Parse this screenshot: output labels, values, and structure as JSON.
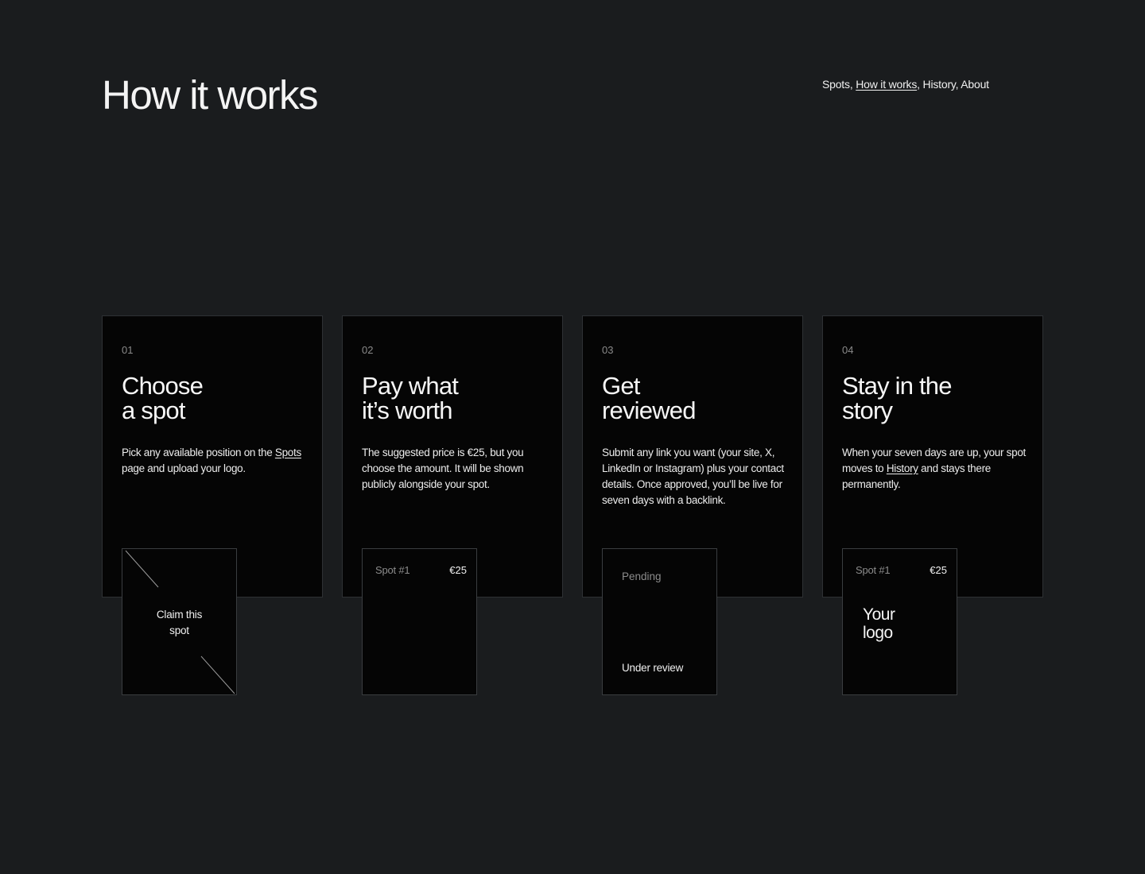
{
  "header": {
    "title": "How it works"
  },
  "nav": {
    "items": [
      {
        "label": "Spots",
        "sep": ", "
      },
      {
        "label": "How it works",
        "sep": ", "
      },
      {
        "label": "History",
        "sep": ", "
      },
      {
        "label": "About",
        "sep": ""
      }
    ]
  },
  "steps": [
    {
      "num": "01",
      "title_line1": "Choose",
      "title_line2": "a spot",
      "desc_before": "Pick any available position on the ",
      "desc_link": "Spots",
      "desc_after": " page and upload your logo."
    },
    {
      "num": "02",
      "title_line1": "Pay what",
      "title_line2": "it’s worth",
      "desc": "The suggested price is €25, but you choose the amount. It will be shown publicly alongside your spot."
    },
    {
      "num": "03",
      "title_line1": "Get",
      "title_line2": "reviewed",
      "desc": "Submit any link you want (your site, X, LinkedIn or Instagram) plus your contact details. Once approved, you’ll be live for seven days with a backlink."
    },
    {
      "num": "04",
      "title_line1": "Stay in the",
      "title_line2": "story",
      "desc_before": "When your seven days are up, your spot moves to ",
      "desc_link": "History",
      "desc_after": " and stays there permanently."
    }
  ],
  "previews": {
    "claim": {
      "line1": "Claim this",
      "line2": "spot"
    },
    "pay": {
      "spot": "Spot #1",
      "price": "€25"
    },
    "review": {
      "status": "Pending",
      "note": "Under review"
    },
    "story": {
      "spot": "Spot #1",
      "price": "€25",
      "logo_line1": "Your",
      "logo_line2": "logo"
    }
  }
}
